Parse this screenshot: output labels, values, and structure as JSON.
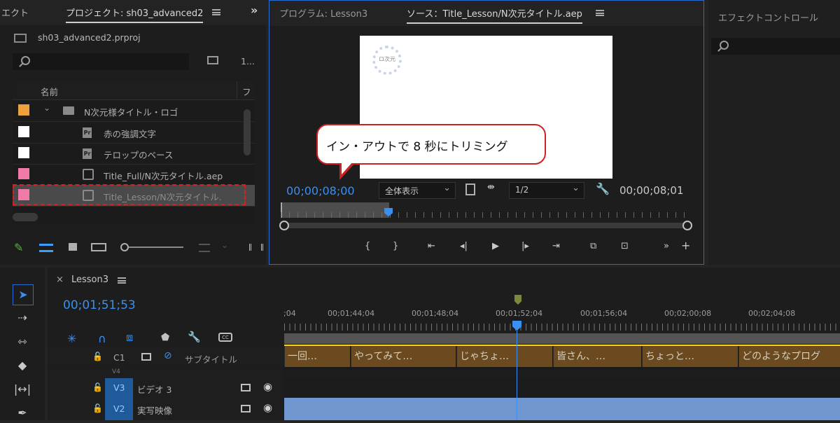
{
  "project_panel": {
    "tab_left": "エクト",
    "tab_active": "プロジェクト: sh03_advanced2",
    "filename": "sh03_advanced2.prproj",
    "item_count": "1...",
    "col_name": "名前",
    "col_right": "フ",
    "items": [
      {
        "label": "N次元様タイトル・ロゴ",
        "color": "#f0a23a",
        "type": "folder"
      },
      {
        "label": "赤の強調文字",
        "color": "#ffffff",
        "type": "title"
      },
      {
        "label": "テロップのベース",
        "color": "#ffffff",
        "type": "title"
      },
      {
        "label": "Title_Full/N次元タイトル.aep",
        "color": "#f07aa8",
        "type": "comp"
      },
      {
        "label": "Title_Lesson/N次元タイトル.",
        "color": "#f07aa8",
        "type": "comp"
      }
    ]
  },
  "source_panel": {
    "tab_program": "プログラム: Lesson3",
    "tab_source": "ソース：Title_Lesson/N次元タイトル.aep",
    "timecode_in": "00;00;08;00",
    "zoom": "全体表示",
    "resolution": "1/2",
    "timecode_out": "00;00;08;01",
    "logo_text": "ロ次元",
    "callout": "イン・アウトで 8 秒にトリミング"
  },
  "effects_panel": {
    "title": "エフェクトコントロール"
  },
  "timeline": {
    "tab": "Lesson3",
    "timecode": "00;01;51;53",
    "ruler": [
      ";04",
      "00;01;44;04",
      "00;01;48;04",
      "00;01;52;04",
      "00;01;56;04",
      "00;02;00;08",
      "00;02;04;08"
    ],
    "tracks": [
      {
        "id": "C1",
        "name": "サブタイトル"
      },
      {
        "id": "V4",
        "name": ""
      },
      {
        "id": "V3",
        "name": "ビデオ 3"
      },
      {
        "id": "V2",
        "name": "実写映像"
      }
    ],
    "clips": [
      "一回…",
      "やってみて…",
      "じゃちょ…",
      "皆さん、…",
      "ちょっと…",
      "どのようなプログ"
    ]
  }
}
